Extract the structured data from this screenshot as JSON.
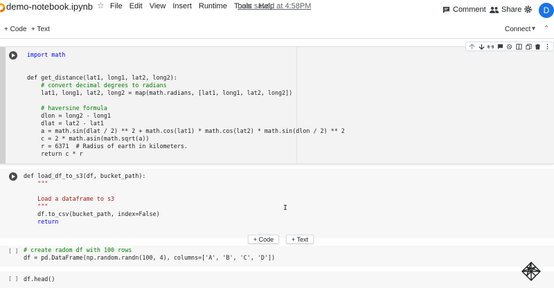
{
  "header": {
    "title": "demo-notebook.ipynb",
    "menu": [
      "File",
      "Edit",
      "View",
      "Insert",
      "Runtime",
      "Tools",
      "Help"
    ],
    "saved": "Last saved at 4:58PM",
    "comment": "Comment",
    "share": "Share",
    "avatar": "D"
  },
  "toolbar": {
    "add_code": "+ Code",
    "add_text": "+ Text",
    "connect": "Connect"
  },
  "cells": {
    "cell1_lines": [
      "import math",
      "",
      "",
      "def get_distance(lat1, long1, lat2, long2):",
      "    # convert decimal degrees to radians",
      "    lat1, long1, lat2, long2 = map(math.radians, [lat1, long1, lat2, long2])",
      "",
      "    # haversine formula",
      "    dlon = long2 - long1",
      "    dlat = lat2 - lat1",
      "    a = math.sin(dlat / 2) ** 2 + math.cos(lat1) * math.cos(lat2) * math.sin(dlon / 2) ** 2",
      "    c = 2 * math.asin(math.sqrt(a))",
      "    r = 6371  # Radius of earth in kilometers.",
      "    return c * r"
    ],
    "cell2_lines": [
      "def load_df_to_s3(df, bucket_path):",
      "    \"\"\"",
      "",
      "    Load a dataframe to s3",
      "    \"\"\"",
      "    df.to_csv(bucket_path, index=False)",
      "    return"
    ],
    "cell3_lines": [
      "# create radom df with 100 rows",
      "df = pd.DataFrame(np.random.randn(100, 4), columns=['A', 'B', 'C', 'D'])"
    ],
    "cell4_lines": [
      "df.head()"
    ],
    "cell3_bracket": "[ ]",
    "cell4_bracket": "[ ]"
  },
  "insert_bar": {
    "code": "+ Code",
    "text": "+ Text"
  }
}
